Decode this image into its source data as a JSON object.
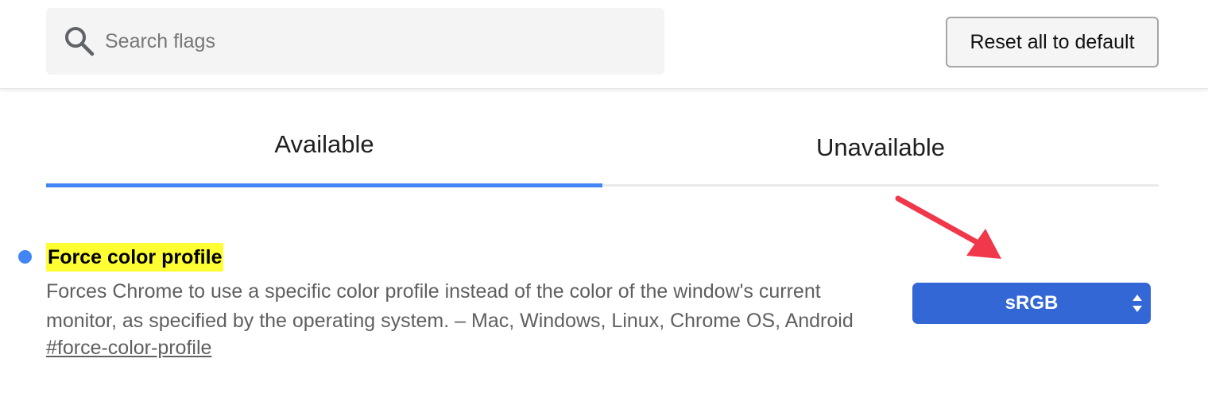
{
  "search": {
    "placeholder": "Search flags",
    "icon": "search-icon"
  },
  "header": {
    "reset_label": "Reset all to default"
  },
  "tabs": [
    {
      "label": "Available",
      "active": true
    },
    {
      "label": "Unavailable",
      "active": false
    }
  ],
  "flag": {
    "title": "Force color profile",
    "description": "Forces Chrome to use a specific color profile instead of the color of the window's current monitor, as specified by the operating system. – Mac, Windows, Linux, Chrome OS, Android",
    "link": "#force-color-profile",
    "selected_option": "sRGB",
    "enabled": true
  },
  "colors": {
    "accent": "#4285f4",
    "select_background": "#3367d6",
    "highlight": "#ffff33",
    "annotation_arrow": "#f0384a"
  }
}
